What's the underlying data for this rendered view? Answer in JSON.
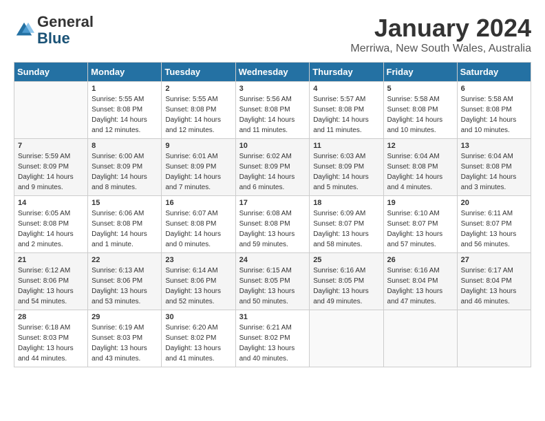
{
  "header": {
    "logo_line1": "General",
    "logo_line2": "Blue",
    "month_title": "January 2024",
    "location": "Merriwa, New South Wales, Australia"
  },
  "days_of_week": [
    "Sunday",
    "Monday",
    "Tuesday",
    "Wednesday",
    "Thursday",
    "Friday",
    "Saturday"
  ],
  "weeks": [
    [
      {
        "day": "",
        "info": ""
      },
      {
        "day": "1",
        "info": "Sunrise: 5:55 AM\nSunset: 8:08 PM\nDaylight: 14 hours\nand 12 minutes."
      },
      {
        "day": "2",
        "info": "Sunrise: 5:55 AM\nSunset: 8:08 PM\nDaylight: 14 hours\nand 12 minutes."
      },
      {
        "day": "3",
        "info": "Sunrise: 5:56 AM\nSunset: 8:08 PM\nDaylight: 14 hours\nand 11 minutes."
      },
      {
        "day": "4",
        "info": "Sunrise: 5:57 AM\nSunset: 8:08 PM\nDaylight: 14 hours\nand 11 minutes."
      },
      {
        "day": "5",
        "info": "Sunrise: 5:58 AM\nSunset: 8:08 PM\nDaylight: 14 hours\nand 10 minutes."
      },
      {
        "day": "6",
        "info": "Sunrise: 5:58 AM\nSunset: 8:08 PM\nDaylight: 14 hours\nand 10 minutes."
      }
    ],
    [
      {
        "day": "7",
        "info": "Sunrise: 5:59 AM\nSunset: 8:09 PM\nDaylight: 14 hours\nand 9 minutes."
      },
      {
        "day": "8",
        "info": "Sunrise: 6:00 AM\nSunset: 8:09 PM\nDaylight: 14 hours\nand 8 minutes."
      },
      {
        "day": "9",
        "info": "Sunrise: 6:01 AM\nSunset: 8:09 PM\nDaylight: 14 hours\nand 7 minutes."
      },
      {
        "day": "10",
        "info": "Sunrise: 6:02 AM\nSunset: 8:09 PM\nDaylight: 14 hours\nand 6 minutes."
      },
      {
        "day": "11",
        "info": "Sunrise: 6:03 AM\nSunset: 8:09 PM\nDaylight: 14 hours\nand 5 minutes."
      },
      {
        "day": "12",
        "info": "Sunrise: 6:04 AM\nSunset: 8:08 PM\nDaylight: 14 hours\nand 4 minutes."
      },
      {
        "day": "13",
        "info": "Sunrise: 6:04 AM\nSunset: 8:08 PM\nDaylight: 14 hours\nand 3 minutes."
      }
    ],
    [
      {
        "day": "14",
        "info": "Sunrise: 6:05 AM\nSunset: 8:08 PM\nDaylight: 14 hours\nand 2 minutes."
      },
      {
        "day": "15",
        "info": "Sunrise: 6:06 AM\nSunset: 8:08 PM\nDaylight: 14 hours\nand 1 minute."
      },
      {
        "day": "16",
        "info": "Sunrise: 6:07 AM\nSunset: 8:08 PM\nDaylight: 14 hours\nand 0 minutes."
      },
      {
        "day": "17",
        "info": "Sunrise: 6:08 AM\nSunset: 8:08 PM\nDaylight: 13 hours\nand 59 minutes."
      },
      {
        "day": "18",
        "info": "Sunrise: 6:09 AM\nSunset: 8:07 PM\nDaylight: 13 hours\nand 58 minutes."
      },
      {
        "day": "19",
        "info": "Sunrise: 6:10 AM\nSunset: 8:07 PM\nDaylight: 13 hours\nand 57 minutes."
      },
      {
        "day": "20",
        "info": "Sunrise: 6:11 AM\nSunset: 8:07 PM\nDaylight: 13 hours\nand 56 minutes."
      }
    ],
    [
      {
        "day": "21",
        "info": "Sunrise: 6:12 AM\nSunset: 8:06 PM\nDaylight: 13 hours\nand 54 minutes."
      },
      {
        "day": "22",
        "info": "Sunrise: 6:13 AM\nSunset: 8:06 PM\nDaylight: 13 hours\nand 53 minutes."
      },
      {
        "day": "23",
        "info": "Sunrise: 6:14 AM\nSunset: 8:06 PM\nDaylight: 13 hours\nand 52 minutes."
      },
      {
        "day": "24",
        "info": "Sunrise: 6:15 AM\nSunset: 8:05 PM\nDaylight: 13 hours\nand 50 minutes."
      },
      {
        "day": "25",
        "info": "Sunrise: 6:16 AM\nSunset: 8:05 PM\nDaylight: 13 hours\nand 49 minutes."
      },
      {
        "day": "26",
        "info": "Sunrise: 6:16 AM\nSunset: 8:04 PM\nDaylight: 13 hours\nand 47 minutes."
      },
      {
        "day": "27",
        "info": "Sunrise: 6:17 AM\nSunset: 8:04 PM\nDaylight: 13 hours\nand 46 minutes."
      }
    ],
    [
      {
        "day": "28",
        "info": "Sunrise: 6:18 AM\nSunset: 8:03 PM\nDaylight: 13 hours\nand 44 minutes."
      },
      {
        "day": "29",
        "info": "Sunrise: 6:19 AM\nSunset: 8:03 PM\nDaylight: 13 hours\nand 43 minutes."
      },
      {
        "day": "30",
        "info": "Sunrise: 6:20 AM\nSunset: 8:02 PM\nDaylight: 13 hours\nand 41 minutes."
      },
      {
        "day": "31",
        "info": "Sunrise: 6:21 AM\nSunset: 8:02 PM\nDaylight: 13 hours\nand 40 minutes."
      },
      {
        "day": "",
        "info": ""
      },
      {
        "day": "",
        "info": ""
      },
      {
        "day": "",
        "info": ""
      }
    ]
  ]
}
